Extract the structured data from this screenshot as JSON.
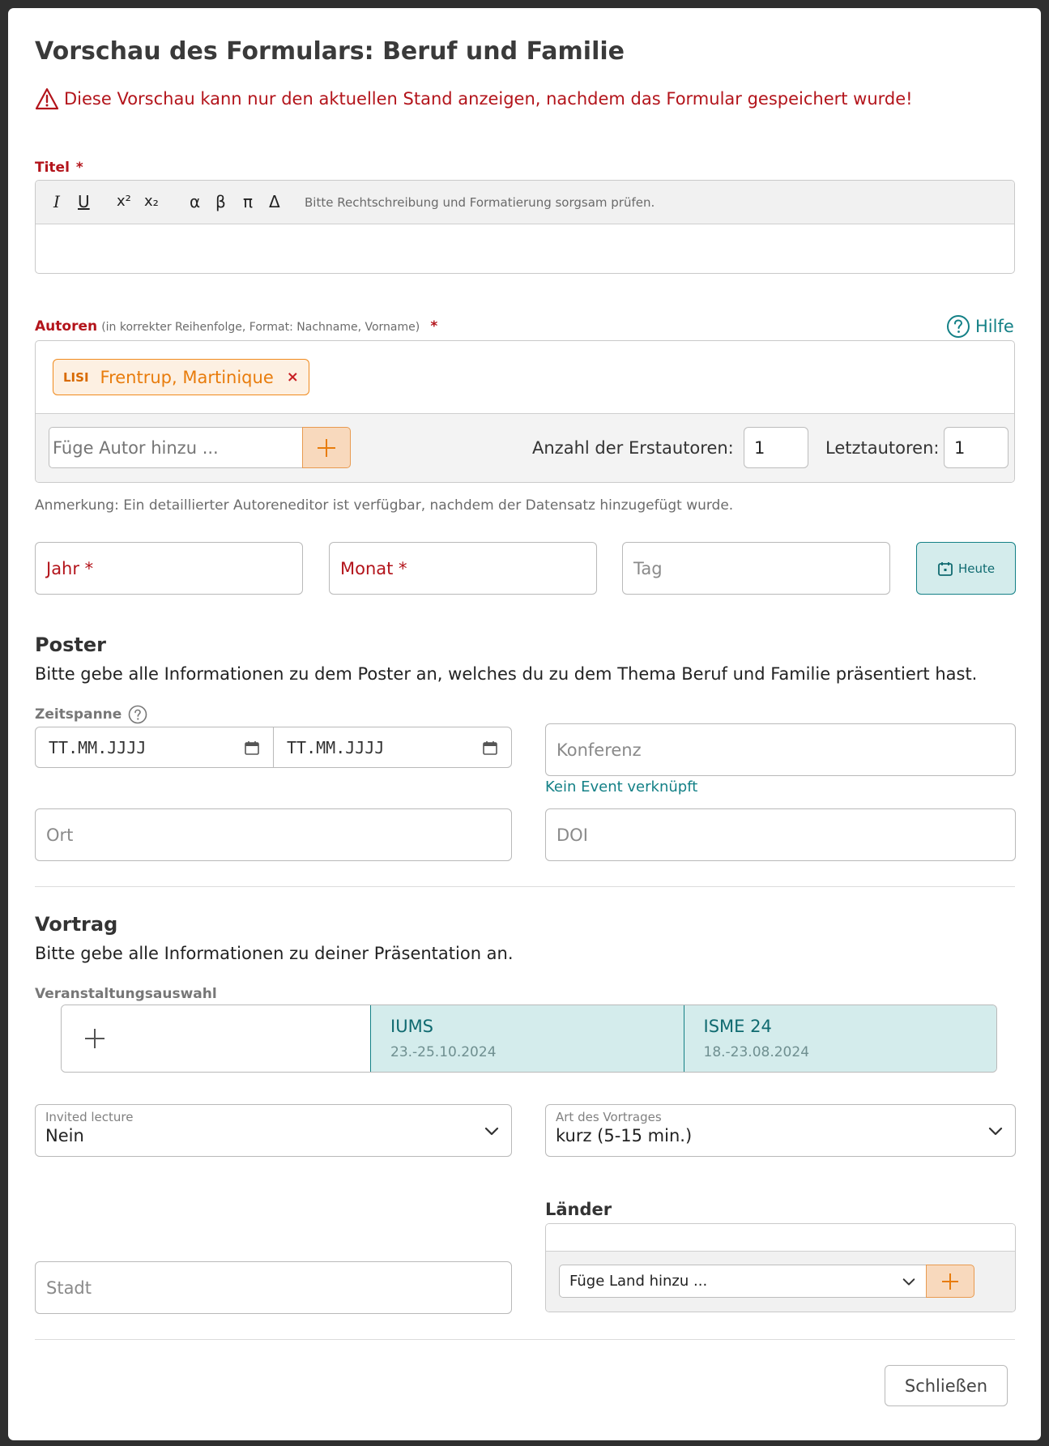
{
  "modal": {
    "title": "Vorschau des Formulars: Beruf und Familie",
    "warning": "Diese Vorschau kann nur den aktuellen Stand anzeigen, nachdem das Formular gespeichert wurde!"
  },
  "titel_field": {
    "label": "Titel",
    "required_mark": "*",
    "toolbar": {
      "italic": "I",
      "underline": "U",
      "superscript": "x²",
      "subscript": "x₂",
      "alpha": "α",
      "beta": "β",
      "pi": "π",
      "delta": "Δ",
      "hint": "Bitte Rechtschreibung und Formatierung sorgsam prüfen."
    },
    "value": ""
  },
  "authors": {
    "label": "Autoren",
    "hint": "(in korrekter Reihenfolge, Format: Nachname, Vorname)",
    "required_mark": "*",
    "help_label": "Hilfe",
    "tags": [
      {
        "badge": "LISI",
        "name": "Frentrup, Martinique",
        "remove": "×"
      }
    ],
    "add_placeholder": "Füge Autor hinzu ...",
    "first_authors_label": "Anzahl der Erstautoren:",
    "first_authors_value": "1",
    "last_authors_label": "Letztautoren:",
    "last_authors_value": "1",
    "note": "Anmerkung: Ein detaillierter Autoreneditor ist verfügbar, nachdem der Datensatz hinzugefügt wurde."
  },
  "date": {
    "year_placeholder": "Jahr *",
    "month_placeholder": "Monat *",
    "day_placeholder": "Tag",
    "today_label": "Heute"
  },
  "poster": {
    "title": "Poster",
    "description": "Bitte gebe alle Informationen zu dem Poster an, welches du zu dem Thema Beruf und Familie präsentiert hast.",
    "timespan_label": "Zeitspanne",
    "date_from_placeholder": "TT.MM.JJJJ",
    "date_to_placeholder": "TT.MM.JJJJ",
    "conference_placeholder": "Konferenz",
    "no_event_link": "Kein Event verknüpft",
    "place_placeholder": "Ort",
    "doi_placeholder": "DOI"
  },
  "vortrag": {
    "title": "Vortrag",
    "description": "Bitte gebe alle Informationen zu deiner Präsentation an.",
    "event_select_label": "Veranstaltungsauswahl",
    "events": [
      {
        "name": "IUMS",
        "dates": "23.-25.10.2024"
      },
      {
        "name": "ISME 24",
        "dates": "18.-23.08.2024"
      }
    ],
    "invited_label": "Invited lecture",
    "invited_value": "Nein",
    "talk_type_label": "Art des Vortrages",
    "talk_type_value": "kurz (5-15 min.)",
    "countries_label": "Länder",
    "add_country_placeholder": "Füge Land hinzu ...",
    "city_placeholder": "Stadt"
  },
  "footer": {
    "close_label": "Schließen"
  },
  "colors": {
    "accent_teal": "#138086",
    "error_red": "#b3141b",
    "orange": "#e87c0c"
  }
}
